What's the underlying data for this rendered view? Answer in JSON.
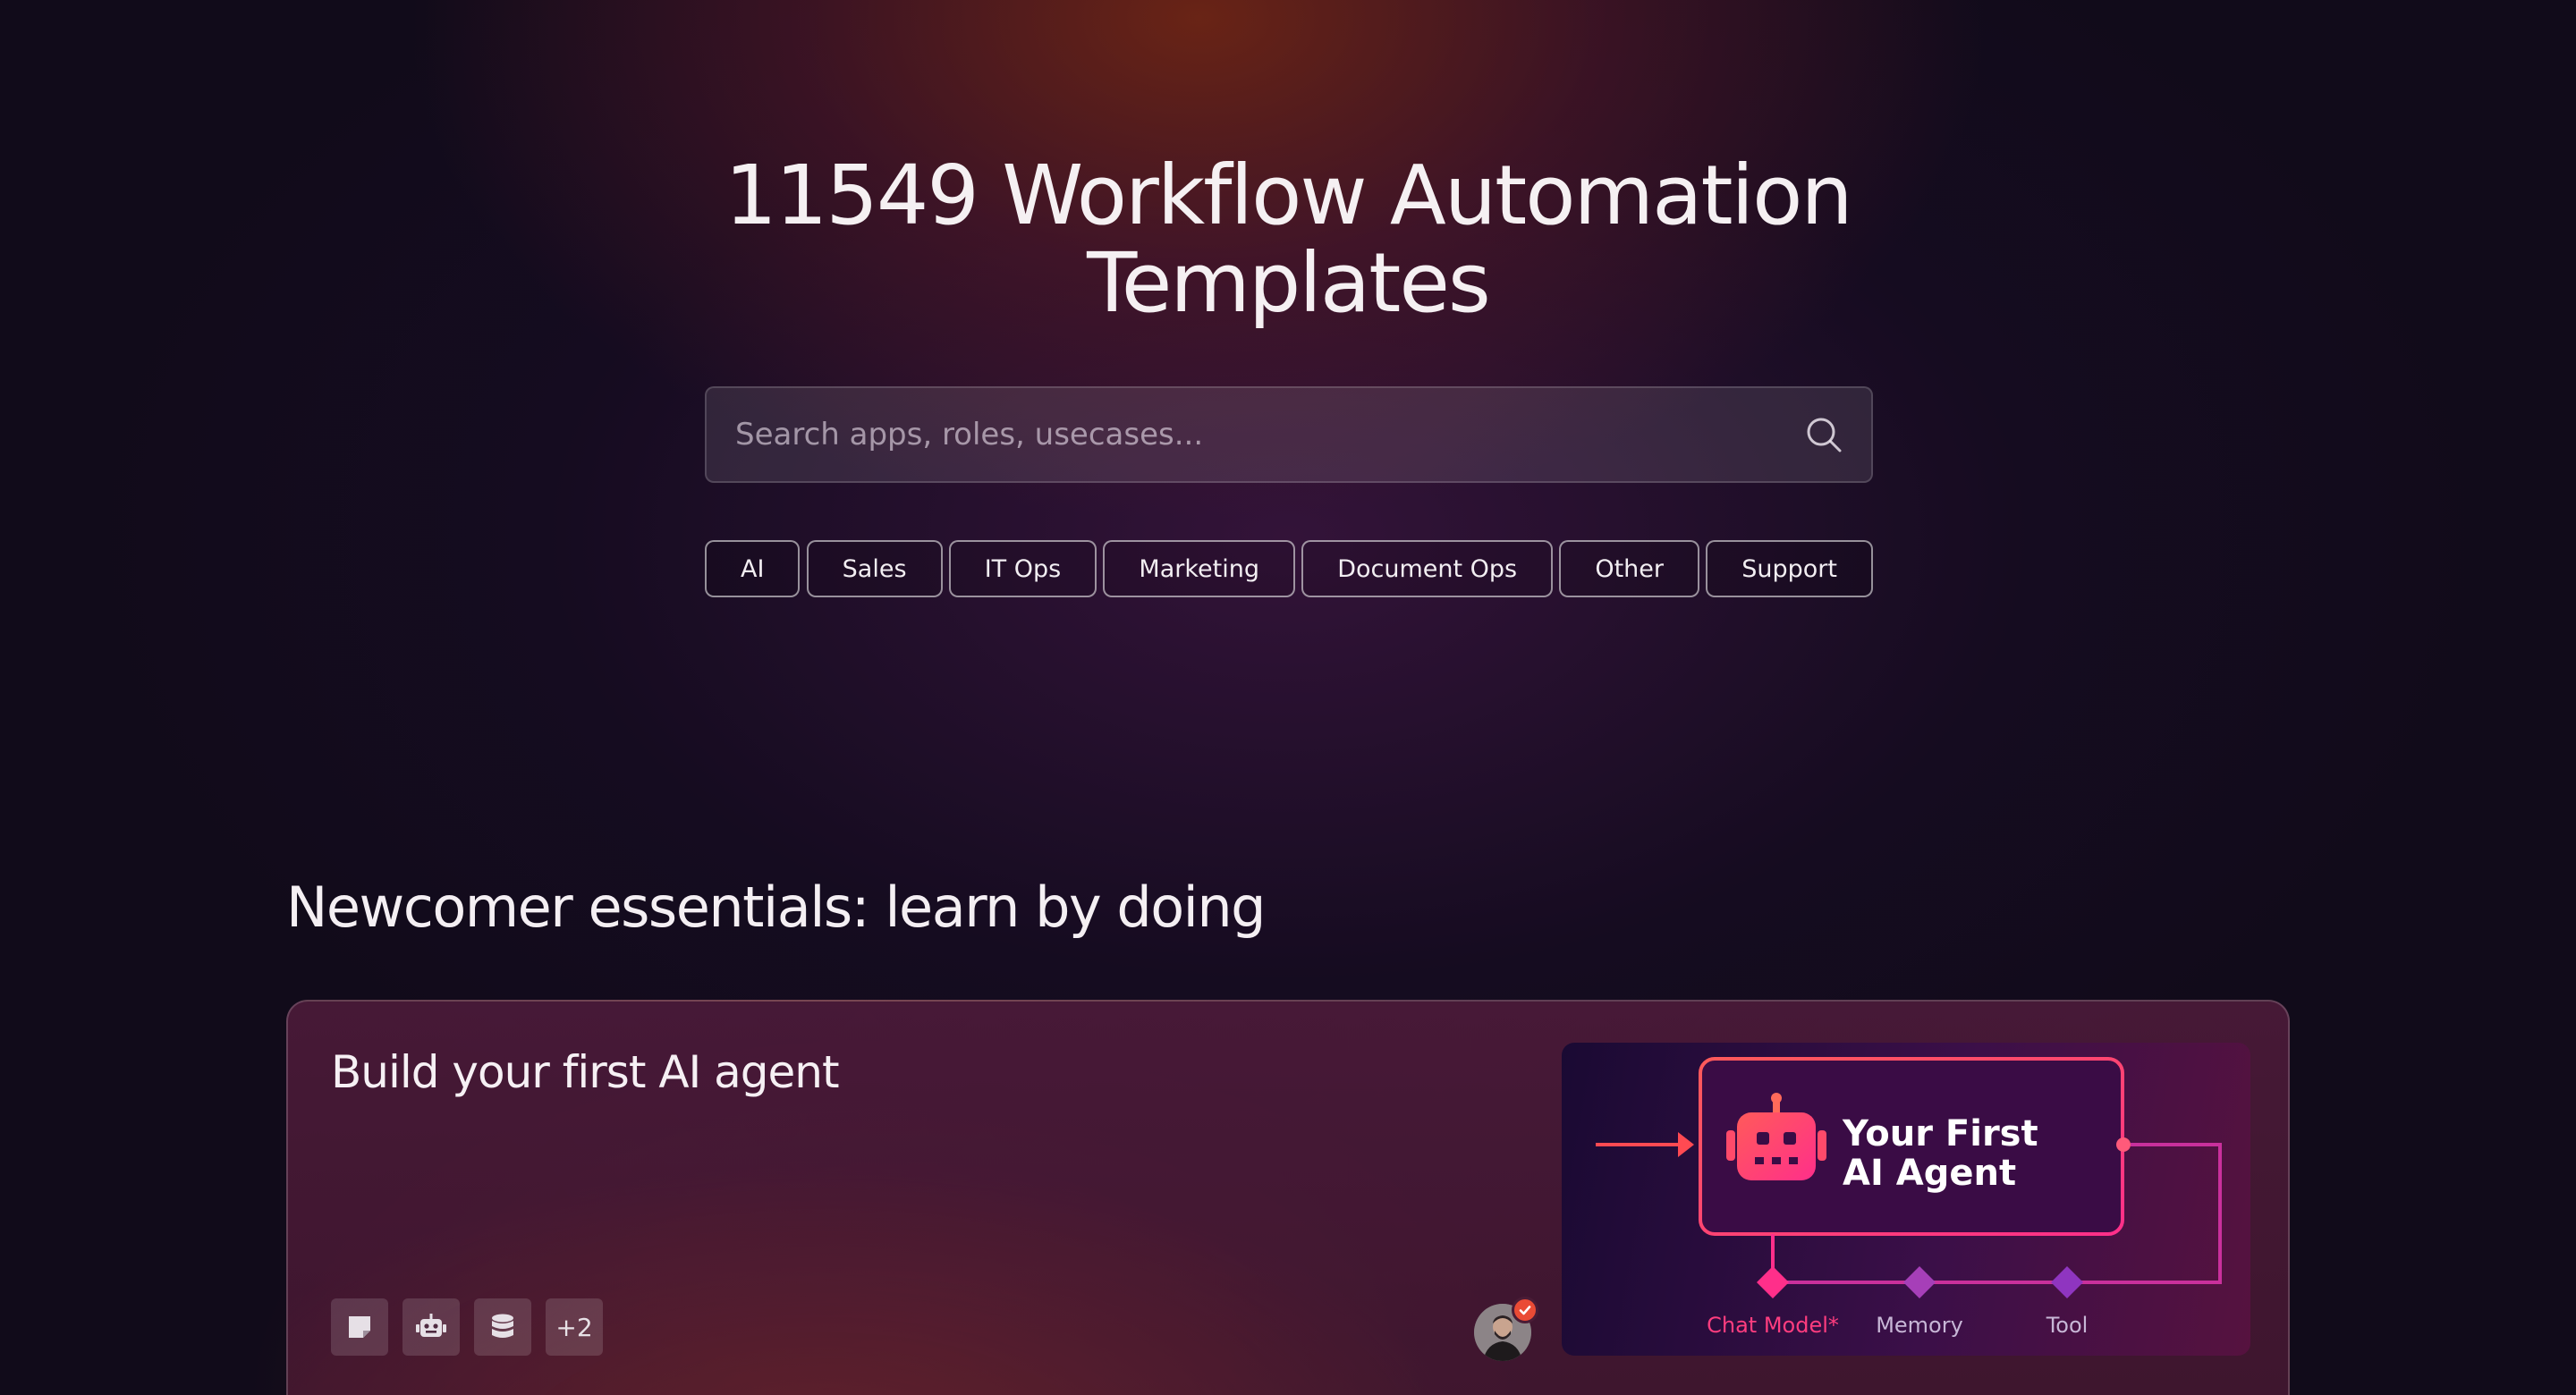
{
  "hero": {
    "title_line1": "11549 Workflow Automation",
    "title_line2": "Templates"
  },
  "search": {
    "placeholder": "Search apps, roles, usecases...",
    "icon": "search-icon"
  },
  "categories": [
    "AI",
    "Sales",
    "IT Ops",
    "Marketing",
    "Document Ops",
    "Other",
    "Support"
  ],
  "section": {
    "title": "Newcomer essentials: learn by doing"
  },
  "card": {
    "title": "Build your first AI agent",
    "node_icons": [
      "sticky-note-icon",
      "robot-icon",
      "database-icon"
    ],
    "more_count": "+2",
    "author_avatar": "avatar",
    "verified_badge": "verified-check-icon",
    "preview": {
      "title": "Your First\nAI Agent",
      "labels": {
        "chat_model": "Chat Model*",
        "memory": "Memory",
        "tool": "Tool"
      },
      "colors": {
        "chat_model": "#ff3d7f",
        "memory": "#b06ab3",
        "tool": "#b06ab3",
        "accent": "#ff5a5a"
      }
    }
  },
  "colors": {
    "background": "#110b1a",
    "hero_glow": "#7a2814",
    "card_bg": "#501c3c",
    "verified": "#ea4b35"
  }
}
